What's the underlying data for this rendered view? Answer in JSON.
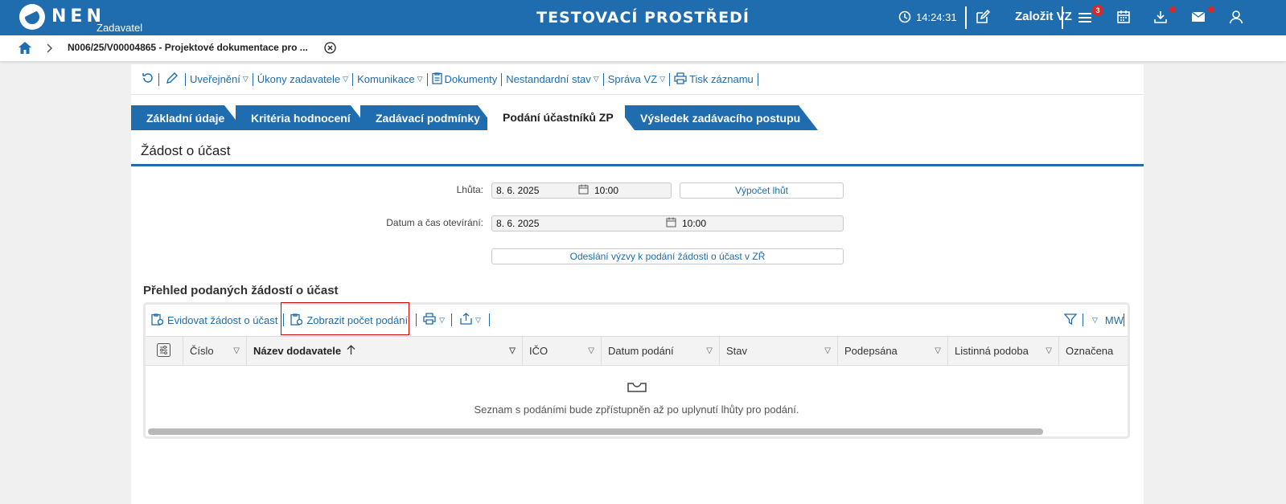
{
  "header": {
    "brand": "NEN",
    "sub": "Zadavatel",
    "title": "TESTOVACÍ PROSTŘEDÍ",
    "time": "14:24:31",
    "create_label": "Založit VZ",
    "menu_badge": "3"
  },
  "breadcrumb": {
    "text": "N006/25/V00004865 - Projektové dokumentace pro ..."
  },
  "toolbar": {
    "items": [
      "Uveřejnění",
      "Úkony zadavatele",
      "Komunikace",
      "Dokumenty",
      "Nestandardní stav",
      "Správa VZ",
      "Tisk záznamu"
    ]
  },
  "tabs": [
    "Základní údaje",
    "Kritéria hodnocení",
    "Zadávací podmínky",
    "Podání účastníků ZP",
    "Výsledek zadávacího postupu"
  ],
  "section": {
    "title": "Žádost o účast"
  },
  "form": {
    "lhuta_label": "Lhůta:",
    "lhuta_date": "8. 6. 2025",
    "lhuta_time": "10:00",
    "vypocet_label": "Výpočet lhůt",
    "open_label": "Datum a čas otevírání:",
    "open_date": "8. 6. 2025",
    "open_time": "10:00",
    "send_label": "Odeslání výzvy k podání žádosti o účast v ZŘ"
  },
  "overview": {
    "title": "Přehled podaných žádostí o účast",
    "evidovat": "Evidovat žádost o účast",
    "zobrazit": "Zobrazit počet podání",
    "mw": "MW",
    "columns": [
      "Číslo",
      "Název dodavatele",
      "IČO",
      "Datum podání",
      "Stav",
      "Podepsána",
      "Listinná podoba",
      "Označena"
    ],
    "empty_text": "Seznam s podáními bude zpřístupněn až po uplynutí lhůty pro podání."
  }
}
